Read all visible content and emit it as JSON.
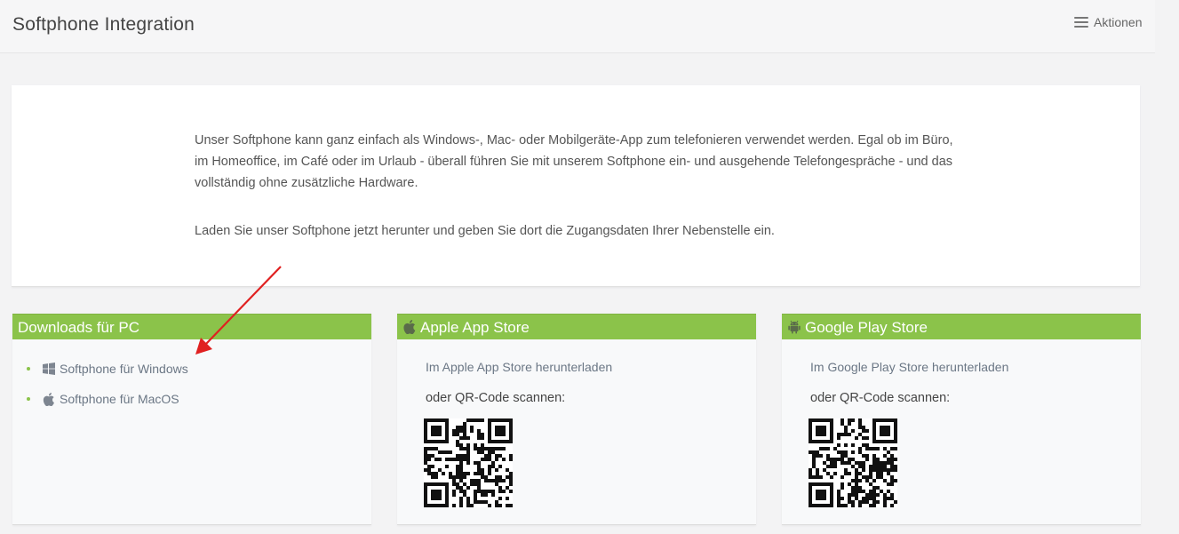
{
  "header": {
    "title": "Softphone Integration",
    "actions_label": "Aktionen",
    "actions_icon": "hamburger-menu-icon"
  },
  "intro": {
    "paragraph1": "Unser Softphone kann ganz einfach als Windows-, Mac- oder Mobilgeräte-App zum telefonieren verwendet werden. Egal ob im Büro, im Homeoffice, im Café oder im Urlaub - überall führen Sie mit unserem Softphone ein- und ausgehende Telefongespräche - und das vollständig ohne zusätzliche Hardware.",
    "paragraph2": "Laden Sie unser Softphone jetzt herunter und geben Sie dort die Zugangsdaten Ihrer Nebenstelle ein."
  },
  "panels": {
    "pc": {
      "title": "Downloads für PC",
      "items": [
        {
          "label": "Softphone für Windows",
          "icon": "windows-icon"
        },
        {
          "label": "Softphone für MacOS",
          "icon": "apple-icon"
        }
      ]
    },
    "apple": {
      "title": "Apple App Store",
      "icon": "apple-icon",
      "link": "Im Apple App Store herunterladen",
      "qr_label": "oder QR-Code scannen:"
    },
    "google": {
      "title": "Google Play Store",
      "icon": "android-icon",
      "link": "Im Google Play Store herunterladen",
      "qr_label": "oder QR-Code scannen:"
    }
  },
  "colors": {
    "accent_green": "#8bc34a",
    "annotation_arrow": "#e02020"
  }
}
